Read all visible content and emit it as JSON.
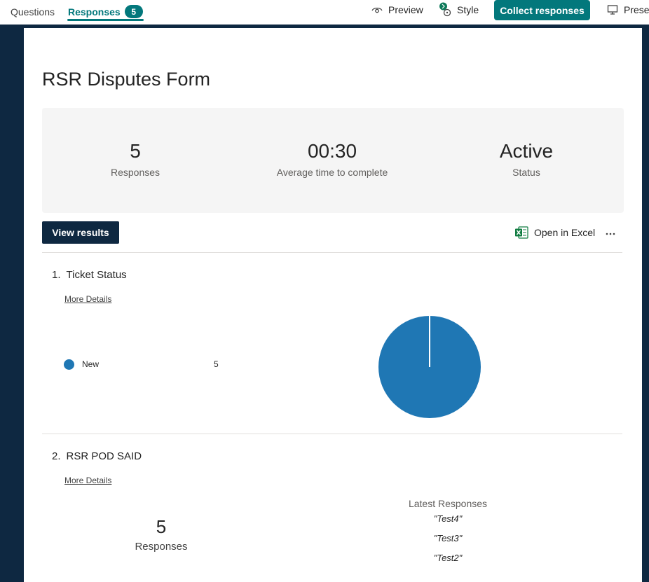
{
  "topbar": {
    "tabs": [
      {
        "label": "Questions"
      },
      {
        "label": "Responses",
        "badge": "5"
      }
    ],
    "preview_label": "Preview",
    "style_label": "Style",
    "collect_label": "Collect responses",
    "present_label": "Presen"
  },
  "form": {
    "title": "RSR Disputes Form",
    "stats": [
      {
        "value": "5",
        "label": "Responses"
      },
      {
        "value": "00:30",
        "label": "Average time to complete"
      },
      {
        "value": "Active",
        "label": "Status"
      }
    ],
    "view_results_label": "View results",
    "open_excel_label": "Open in Excel",
    "more_options_icon": "ellipsis-icon"
  },
  "questions": [
    {
      "number": "1.",
      "title": "Ticket Status",
      "more_details": "More Details",
      "legend": [
        {
          "label": "New",
          "count": "5",
          "color": "#1f77b4"
        }
      ]
    },
    {
      "number": "2.",
      "title": "RSR POD SAID",
      "more_details": "More Details",
      "responses_count": "5",
      "responses_label": "Responses",
      "latest_header": "Latest Responses",
      "latest": [
        "\"Test4\"",
        "\"Test3\"",
        "\"Test2\""
      ]
    }
  ],
  "chart_data": {
    "type": "pie",
    "categories": [
      "New"
    ],
    "values": [
      5
    ],
    "colors": [
      "#1f77b4"
    ]
  },
  "colors": {
    "accent": "#03787c",
    "navy": "#0e2841",
    "pie": "#1f77b4"
  }
}
